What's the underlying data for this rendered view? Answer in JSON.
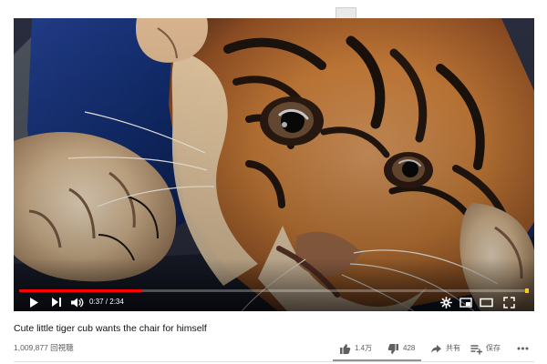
{
  "video": {
    "title": "Cute little tiger cub wants the chair for himself",
    "time_display": "0:37 / 2:34",
    "progress_played": 0.24,
    "progress_loaded": 0.24
  },
  "stats": {
    "views": "1,009,877 回視聴",
    "like_count": "1.4万",
    "dislike_count": "428",
    "share_label": "共有",
    "save_label": "保存"
  },
  "icons": {
    "play": "play-icon",
    "next": "next-icon",
    "volume": "volume-icon",
    "settings": "gear-icon",
    "miniplayer": "miniplayer-icon",
    "theater": "theater-icon",
    "fullscreen": "fullscreen-icon",
    "like": "thumbs-up-icon",
    "dislike": "thumbs-down-icon",
    "share": "share-icon",
    "save": "save-to-playlist-icon",
    "more": "more-icon"
  },
  "colors": {
    "progress": "#ff0000",
    "page": "#ffffff",
    "title": "#111111",
    "secondary": "#606060"
  }
}
